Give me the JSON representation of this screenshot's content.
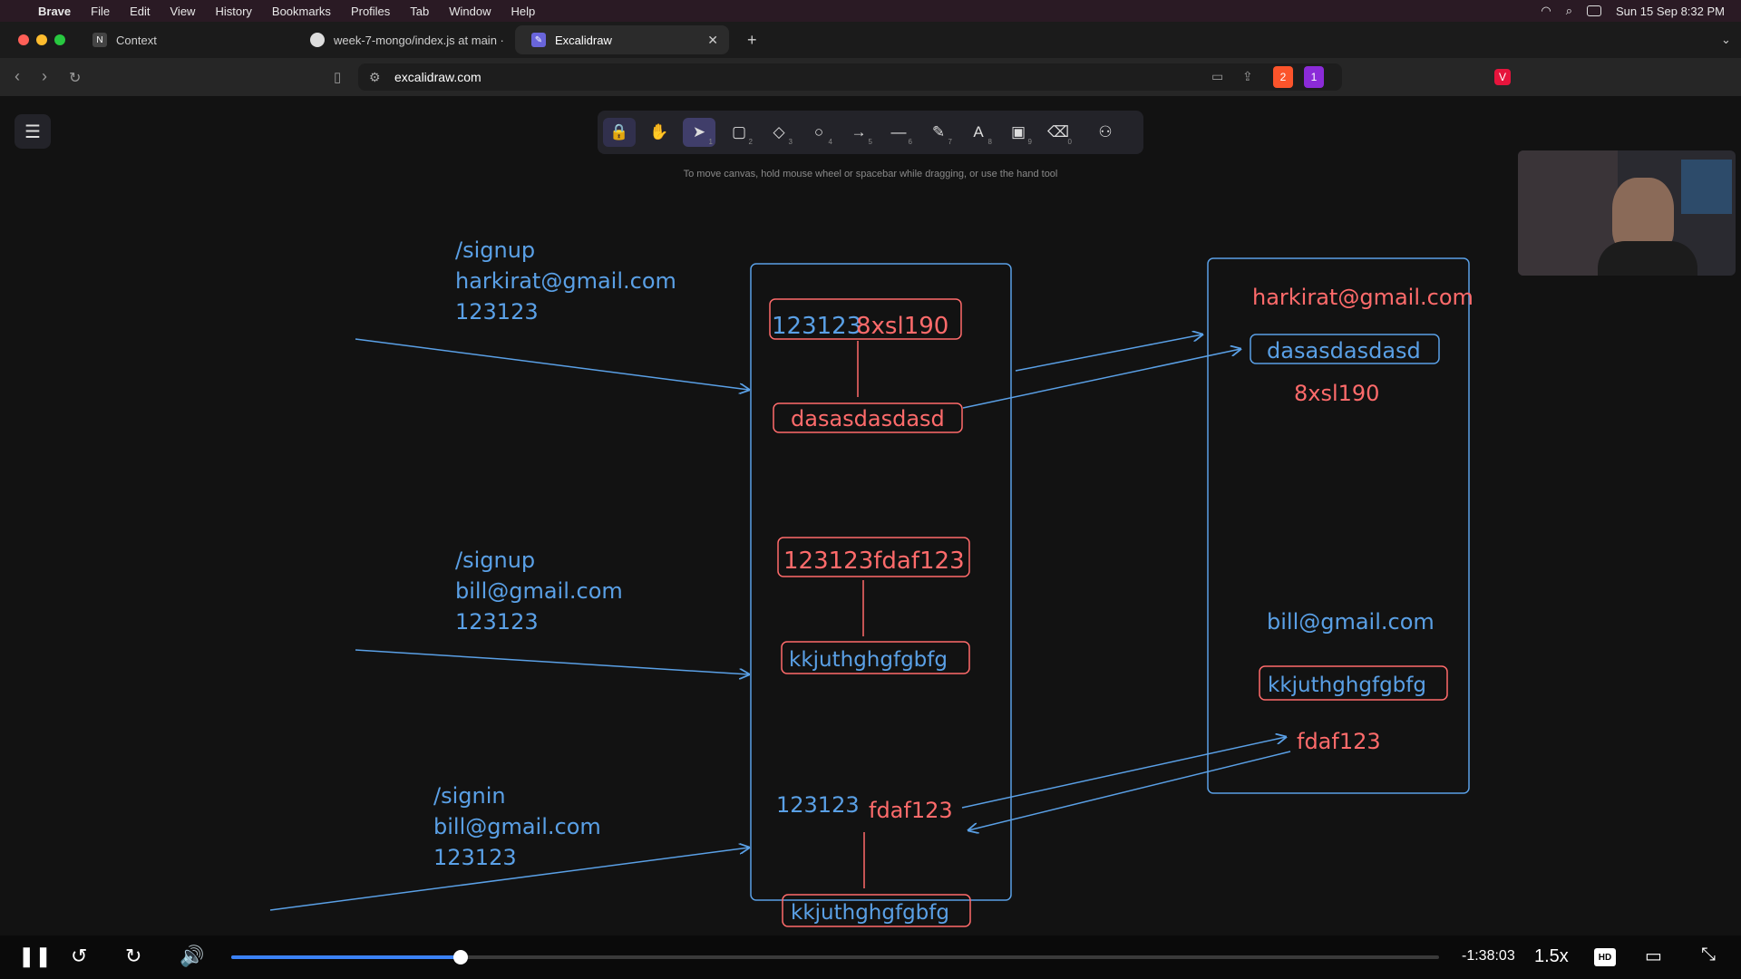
{
  "menubar": {
    "app": "Brave",
    "items": [
      "File",
      "Edit",
      "View",
      "History",
      "Bookmarks",
      "Profiles",
      "Tab",
      "Window",
      "Help"
    ],
    "datetime": "Sun 15 Sep  8:32 PM"
  },
  "tabs": [
    {
      "title": "Context"
    },
    {
      "title": "week-7-mongo/index.js at main ·"
    },
    {
      "title": "Excalidraw"
    }
  ],
  "address": {
    "url": "excalidraw.com",
    "shield_count": "2",
    "alert_count": "1"
  },
  "toolbar": {
    "tools": [
      {
        "name": "lock",
        "num": ""
      },
      {
        "name": "hand",
        "num": ""
      },
      {
        "name": "selection",
        "num": "1"
      },
      {
        "name": "rectangle",
        "num": "2"
      },
      {
        "name": "diamond",
        "num": "3"
      },
      {
        "name": "ellipse",
        "num": "4"
      },
      {
        "name": "arrow",
        "num": "5"
      },
      {
        "name": "line",
        "num": "6"
      },
      {
        "name": "draw",
        "num": "7"
      },
      {
        "name": "text",
        "num": "8"
      },
      {
        "name": "image",
        "num": "9"
      },
      {
        "name": "eraser",
        "num": "0"
      },
      {
        "name": "extra-tools",
        "num": ""
      }
    ],
    "hint": "To move canvas, hold mouse wheel or spacebar while dragging, or use the hand tool"
  },
  "drawing": {
    "req1": {
      "route": "/signup",
      "email": "harkirat@gmail.com",
      "password": "123123"
    },
    "req2": {
      "route": "/signup",
      "email": "bill@gmail.com",
      "password": "123123"
    },
    "req3": {
      "route": "/signin",
      "email": "bill@gmail.com",
      "password": "123123"
    },
    "server": {
      "box1_pw": "123123",
      "box1_salt": "8xsl190",
      "box1_hash": "dasasdasdasd",
      "box2": "123123fdaf123",
      "box2_hash": "kkjuthghgfgbfg",
      "box3_pw": "123123",
      "box3_salt": "fdaf123",
      "box3_hash": "kkjuthghgfgbfg"
    },
    "db": {
      "email1": "harkirat@gmail.com",
      "hash1": "dasasdasdasd",
      "salt1": "8xsl190",
      "email2": "bill@gmail.com",
      "hash2": "kkjuthghgfgbfg",
      "salt2": "fdaf123"
    }
  },
  "player": {
    "time": "-1:38:03",
    "speed": "1.5x",
    "quality": "HD",
    "progress": 0.19
  },
  "colors": {
    "blue": "#5aa0e6",
    "red": "#ff6b6b",
    "accent": "#3b82f6"
  }
}
